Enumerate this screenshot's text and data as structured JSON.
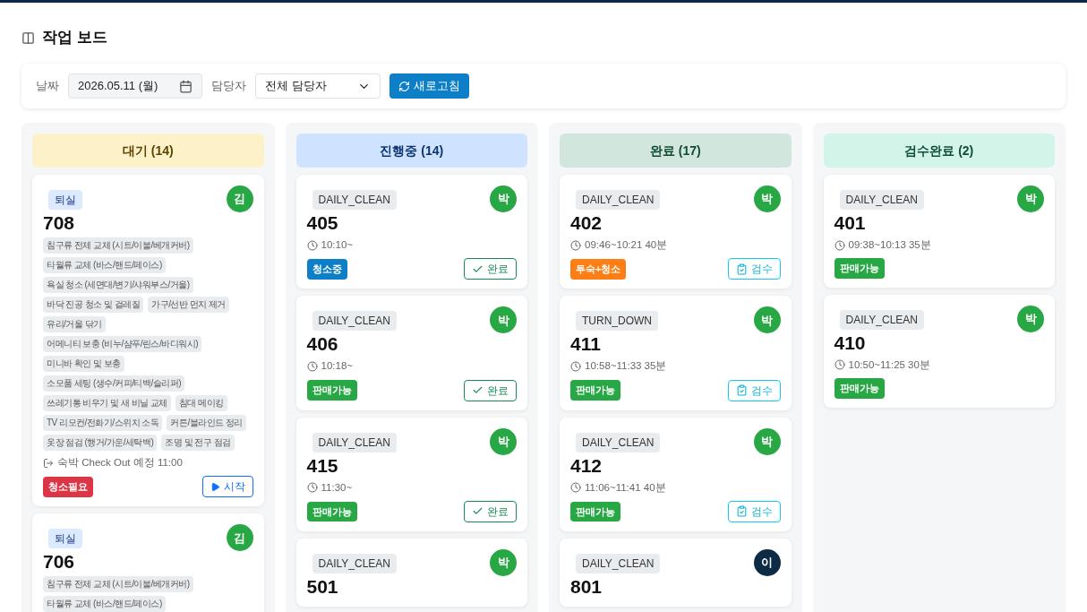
{
  "page": {
    "title": "작업 보드"
  },
  "filters": {
    "date_label": "날짜",
    "date_value": "2026.05.11 (월)",
    "assignee_label": "담당자",
    "assignee_value": "전체 담당자",
    "refresh_button": "새로고침"
  },
  "columns": [
    {
      "kind": "waiting",
      "title": "대기 (14)",
      "cards": [
        {
          "tag": {
            "text": "퇴실",
            "kind": "checkout"
          },
          "assignee": {
            "initial": "김",
            "color": "#28a745"
          },
          "room": "708",
          "tasks": [
            "침구류 전체 교체 (시트/이불/베개커버)",
            "타월류 교체 (바스/핸드/페이스)",
            "욕실 청소 (세면대/변기/샤워부스/거울)",
            "바닥 진공 청소 및 걸레질",
            "가구/선반 먼지 제거",
            "유리/거울 닦기",
            "어메니티 보충 (비누/샴푸/린스/바디워시)",
            "미니바 확인 및 보충",
            "소모품 세팅 (생수/커피/티백/슬리퍼)",
            "쓰레기통 비우기 및 새 비닐 교체",
            "침대 메이킹",
            "TV 리모컨/전화기/스위치 소독",
            "커튼/블라인드 정리",
            "옷장 점검 (행거/가운/세탁백)",
            "조명 및 전구 점검"
          ],
          "note": "숙박 Check Out 예정 11:00",
          "status": {
            "text": "청소필요",
            "color": "#dc3545"
          },
          "action": {
            "kind": "start",
            "label": "시작"
          }
        },
        {
          "tag": {
            "text": "퇴실",
            "kind": "checkout"
          },
          "assignee": {
            "initial": "김",
            "color": "#28a745"
          },
          "room": "706",
          "tasks": [
            "침구류 전체 교체 (시트/이불/베개커버)",
            "타월류 교체 (바스/핸드/페이스)"
          ]
        }
      ]
    },
    {
      "kind": "progress",
      "title": "진행중 (14)",
      "cards": [
        {
          "tag": {
            "text": "DAILY_CLEAN",
            "kind": "service"
          },
          "assignee": {
            "initial": "박",
            "color": "#28a745"
          },
          "room": "405",
          "time": "10:10~",
          "status": {
            "text": "청소중",
            "color": "#0d7fc6"
          },
          "action": {
            "kind": "complete",
            "label": "완료"
          }
        },
        {
          "tag": {
            "text": "DAILY_CLEAN",
            "kind": "service"
          },
          "assignee": {
            "initial": "박",
            "color": "#28a745"
          },
          "room": "406",
          "time": "10:18~",
          "status": {
            "text": "판매가능",
            "color": "#28a745"
          },
          "action": {
            "kind": "complete",
            "label": "완료"
          }
        },
        {
          "tag": {
            "text": "DAILY_CLEAN",
            "kind": "service"
          },
          "assignee": {
            "initial": "박",
            "color": "#28a745"
          },
          "room": "415",
          "time": "11:30~",
          "status": {
            "text": "판매가능",
            "color": "#28a745"
          },
          "action": {
            "kind": "complete",
            "label": "완료"
          }
        },
        {
          "tag": {
            "text": "DAILY_CLEAN",
            "kind": "service"
          },
          "assignee": {
            "initial": "박",
            "color": "#28a745"
          },
          "room": "501"
        }
      ]
    },
    {
      "kind": "done",
      "title": "완료 (17)",
      "cards": [
        {
          "tag": {
            "text": "DAILY_CLEAN",
            "kind": "service"
          },
          "assignee": {
            "initial": "박",
            "color": "#28a745"
          },
          "room": "402",
          "time": "09:46~10:21 40분",
          "status": {
            "text": "투숙+청소",
            "color": "#fd7e14"
          },
          "action": {
            "kind": "inspect",
            "label": "검수"
          }
        },
        {
          "tag": {
            "text": "TURN_DOWN",
            "kind": "service"
          },
          "assignee": {
            "initial": "박",
            "color": "#28a745"
          },
          "room": "411",
          "time": "10:58~11:33 35분",
          "status": {
            "text": "판매가능",
            "color": "#28a745"
          },
          "action": {
            "kind": "inspect",
            "label": "검수"
          }
        },
        {
          "tag": {
            "text": "DAILY_CLEAN",
            "kind": "service"
          },
          "assignee": {
            "initial": "박",
            "color": "#28a745"
          },
          "room": "412",
          "time": "11:06~11:41 40분",
          "status": {
            "text": "판매가능",
            "color": "#28a745"
          },
          "action": {
            "kind": "inspect",
            "label": "검수"
          }
        },
        {
          "tag": {
            "text": "DAILY_CLEAN",
            "kind": "service"
          },
          "assignee": {
            "initial": "이",
            "color": "#0d2b45"
          },
          "room": "801"
        }
      ]
    },
    {
      "kind": "inspected",
      "title": "검수완료 (2)",
      "cards": [
        {
          "tag": {
            "text": "DAILY_CLEAN",
            "kind": "service"
          },
          "assignee": {
            "initial": "박",
            "color": "#28a745"
          },
          "room": "401",
          "time": "09:38~10:13 35분",
          "status": {
            "text": "판매가능",
            "color": "#28a745"
          }
        },
        {
          "tag": {
            "text": "DAILY_CLEAN",
            "kind": "service"
          },
          "assignee": {
            "initial": "박",
            "color": "#28a745"
          },
          "room": "410",
          "time": "10:50~11:25 30분",
          "status": {
            "text": "판매가능",
            "color": "#28a745"
          }
        }
      ]
    }
  ]
}
